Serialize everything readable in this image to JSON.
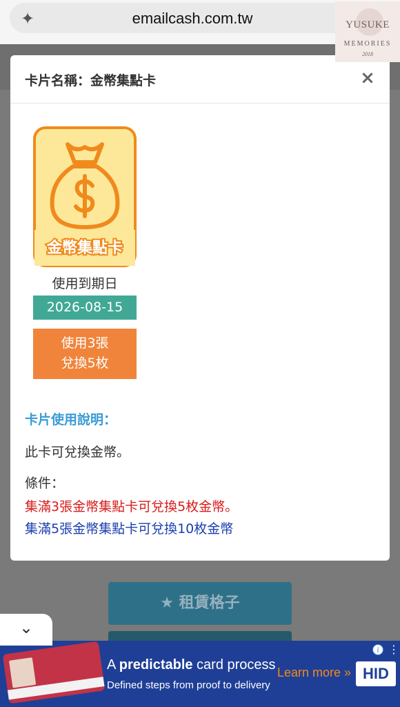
{
  "browser": {
    "url": "emailcash.com.tw"
  },
  "watermark": {
    "title": "YUSUKE",
    "subtitle": "MEMORIES",
    "signature": "2018"
  },
  "modal": {
    "title": "卡片名稱：金幣集點卡",
    "close": "×",
    "card_image_text": "金幣集點卡",
    "expiry_label": "使用到期日",
    "expiry_date": "2026-08-15",
    "exchange_line1": "使用3張",
    "exchange_line2": "兌換5枚",
    "section_title": "卡片使用說明：",
    "description": "此卡可兌換金幣。",
    "conditions_label": "條件：",
    "condition_red": "集滿3張金幣集點卡可兌換5枚金幣。",
    "condition_blue": "集滿5張金幣集點卡可兌換10枚金幣"
  },
  "page": {
    "rent_button": "★ 租賃格子",
    "chevron": "⌄"
  },
  "ad": {
    "headline_bold": "predictable",
    "headline_pre": "A ",
    "headline_post": " card process",
    "sub": "Defined steps from proof to delivery",
    "cta": "Learn more »",
    "logo": "HID",
    "info": "i",
    "more": "⋮"
  },
  "colors": {
    "teal": "#41a896",
    "orange": "#f0843a",
    "blue_title": "#3a9bd6",
    "red": "#d81b1b",
    "navy": "#1a3fae"
  }
}
